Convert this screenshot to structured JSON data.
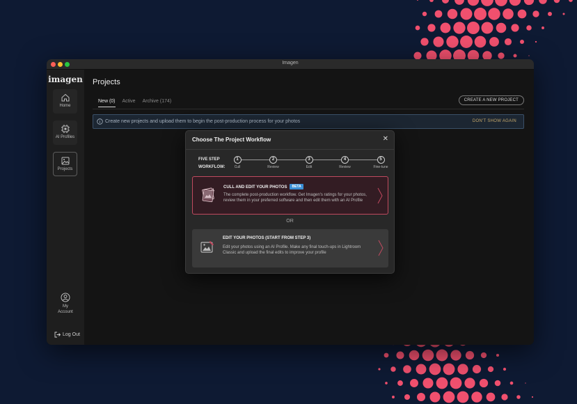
{
  "window": {
    "title": "Imagen"
  },
  "sidebar": {
    "logo": "imagen",
    "items": [
      {
        "label": "Home"
      },
      {
        "label": "AI Profiles"
      },
      {
        "label": "Projects"
      }
    ],
    "account_line1": "My",
    "account_line2": "Account",
    "logout": "Log Out"
  },
  "main": {
    "title": "Projects",
    "tabs": [
      {
        "label": "New (0)"
      },
      {
        "label": "Active"
      },
      {
        "label": "Archive (174)"
      }
    ],
    "create_button": "CREATE A NEW PROJECT",
    "banner": {
      "text": "Create new projects and upload them to begin the post-production process for your photos",
      "dismiss": "DON'T SHOW AGAIN"
    }
  },
  "modal": {
    "title": "Choose The Project Workflow",
    "close": "✕",
    "workflow_label_line1": "FIVE STEP",
    "workflow_label_line2": "WORKFLOW:",
    "steps": [
      {
        "num": "1",
        "label": "Cull"
      },
      {
        "num": "2",
        "label": "Review"
      },
      {
        "num": "3",
        "label": "Edit"
      },
      {
        "num": "4",
        "label": "Review"
      },
      {
        "num": "5",
        "label": "Fine-tune"
      }
    ],
    "option_cull": {
      "title": "CULL AND EDIT YOUR PHOTOS",
      "badge": "BETA",
      "desc": "The complete post-production workflow. Get Imagen's ratings for your photos, review them in your preferred software and then edit them with an AI Profile"
    },
    "or": "OR",
    "option_edit": {
      "title": "EDIT YOUR PHOTOS (START FROM STEP 3)",
      "desc": "Edit your photos using an AI Profile. Make any final touch-ups in Lightroom Classic and upload the final edits to improve your profile"
    }
  },
  "colors": {
    "background": "#0e1a33",
    "dots": "#f0506e",
    "accent_border": "#c04a5f",
    "beta": "#3b8fd6",
    "dismiss": "#c6a86a"
  }
}
